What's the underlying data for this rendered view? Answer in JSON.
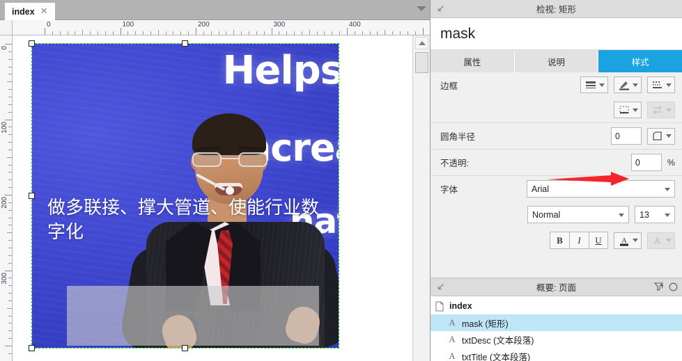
{
  "tabbar": {
    "tabs": [
      {
        "label": "index",
        "close_icon": "close-icon"
      }
    ],
    "menu_icon": "chevron-down-icon"
  },
  "canvas": {
    "ruler_h_labels": [
      "0",
      "100",
      "200",
      "300",
      "400"
    ],
    "ruler_v_labels": [
      "0",
      "100",
      "200",
      "300"
    ],
    "artwork": {
      "background_words": [
        "Helps",
        "ncrea",
        "naf"
      ],
      "caption": "做多联接、撑大管道、使能行业数字化",
      "caption_color": "#ffffff",
      "backdrop_color": "#3a42c8"
    },
    "selection": {
      "handles": 5,
      "border_color": "#16d916"
    },
    "scrollbar": {
      "up_icon": "caret-up-icon"
    }
  },
  "inspector": {
    "titlebar": {
      "collapse_icon": "collapse-arrow-icon",
      "title": "检视: 矩形"
    },
    "widget_name": "mask",
    "tabs": [
      {
        "label": "属性",
        "active": false
      },
      {
        "label": "说明",
        "active": false
      },
      {
        "label": "样式",
        "active": true
      }
    ],
    "style": {
      "border": {
        "label": "边框",
        "buttons": [
          {
            "icon": "line-width-icon",
            "disabled": false
          },
          {
            "icon": "border-color-pencil-icon",
            "disabled": false
          },
          {
            "icon": "line-style-dashed-icon",
            "disabled": false
          },
          {
            "icon": "border-visibility-icon",
            "disabled": false
          },
          {
            "icon": "arrow-style-icon",
            "disabled": true
          }
        ]
      },
      "corner_radius": {
        "label": "圆角半径",
        "value": "0",
        "shape_icon": "rounded-corner-icon"
      },
      "opacity": {
        "label": "不透明:",
        "value": "0",
        "unit": "%"
      },
      "font": {
        "label": "字体",
        "family": "Arial",
        "weight": "Normal",
        "size": "13",
        "bold_label": "B",
        "italic_label": "I",
        "underline_label": "U",
        "color_icon": "font-color-icon",
        "text_style_icon": "text-style-icon"
      }
    }
  },
  "annotation": {
    "arrow_color": "#f5262b",
    "points_to": "opacity-input"
  },
  "outline": {
    "titlebar": {
      "collapse_icon": "collapse-arrow-icon",
      "title": "概要: 页面",
      "filter_icon": "filter-icon",
      "more_icon": "circle-icon"
    },
    "items": [
      {
        "label": "index",
        "icon": "page-icon",
        "level": 0,
        "selected": false
      },
      {
        "label": "mask (矩形)",
        "icon": "text-widget-icon",
        "level": 1,
        "selected": true
      },
      {
        "label": "txtDesc (文本段落)",
        "icon": "text-widget-icon",
        "level": 1,
        "selected": false
      },
      {
        "label": "txtTitle (文本段落)",
        "icon": "text-widget-icon",
        "level": 1,
        "selected": false
      }
    ]
  }
}
